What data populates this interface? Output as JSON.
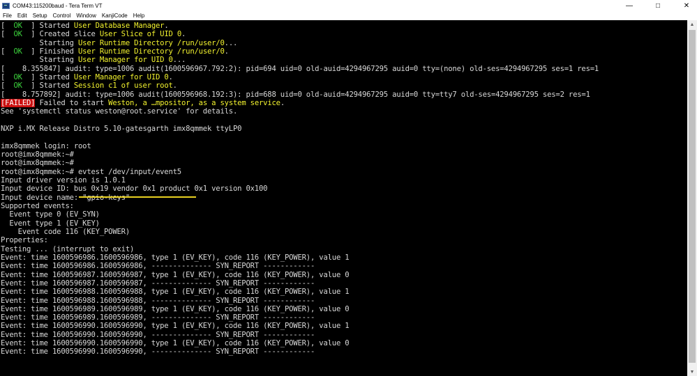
{
  "titlebar": {
    "title": "COM43:115200baud - Tera Term VT",
    "minimize": "—",
    "maximize": "□",
    "close": "✕"
  },
  "menu": [
    "File",
    "Edit",
    "Setup",
    "Control",
    "Window",
    "KanjiCode",
    "Help"
  ],
  "colors": {
    "ok": "#3cd23c",
    "highlight": "#f2f22e",
    "failed_bg": "#cc1010",
    "underline": "#e8d020"
  },
  "terminal": {
    "lines": [
      [
        {
          "t": "[  "
        },
        {
          "t": "OK",
          "c": "ok"
        },
        {
          "t": "  ] Started "
        },
        {
          "t": "User Database Manager",
          "c": "hl"
        },
        {
          "t": "."
        }
      ],
      [
        {
          "t": "[  "
        },
        {
          "t": "OK",
          "c": "ok"
        },
        {
          "t": "  ] Created slice "
        },
        {
          "t": "User Slice of UID 0",
          "c": "hl"
        },
        {
          "t": "."
        }
      ],
      [
        {
          "t": "         Starting "
        },
        {
          "t": "User Runtime Directory /run/user/0",
          "c": "hl"
        },
        {
          "t": "..."
        }
      ],
      [
        {
          "t": "[  "
        },
        {
          "t": "OK",
          "c": "ok"
        },
        {
          "t": "  ] Finished "
        },
        {
          "t": "User Runtime Directory /run/user/0",
          "c": "hl"
        },
        {
          "t": "."
        }
      ],
      [
        {
          "t": "         Starting "
        },
        {
          "t": "User Manager for UID 0",
          "c": "hl"
        },
        {
          "t": "..."
        }
      ],
      [
        {
          "t": "[    8.355847] audit: type=1006 audit(1600596967.792:2): pid=694 uid=0 old-auid=4294967295 auid=0 tty=(none) old-ses=4294967295 ses=1 res=1"
        }
      ],
      [
        {
          "t": "[  "
        },
        {
          "t": "OK",
          "c": "ok"
        },
        {
          "t": "  ] Started "
        },
        {
          "t": "User Manager for UID 0",
          "c": "hl"
        },
        {
          "t": "."
        }
      ],
      [
        {
          "t": "[  "
        },
        {
          "t": "OK",
          "c": "ok"
        },
        {
          "t": "  ] Started "
        },
        {
          "t": "Session c1 of user root",
          "c": "hl"
        },
        {
          "t": "."
        }
      ],
      [
        {
          "t": "[    8.757892] audit: type=1006 audit(1600596968.192:3): pid=688 uid=0 old-auid=4294967295 auid=0 tty=tty7 old-ses=4294967295 ses=2 res=1"
        }
      ],
      [
        {
          "t": "[",
          "c": "fail"
        },
        {
          "t": "FAILED",
          "c": "fail"
        },
        {
          "t": "]",
          "c": "fail"
        },
        {
          "t": " Failed to start "
        },
        {
          "t": "Weston, a …mpositor, as a system service",
          "c": "hl"
        },
        {
          "t": "."
        }
      ],
      [
        {
          "t": "See 'systemctl status weston@root.service' for details."
        }
      ],
      [
        {
          "t": ""
        }
      ],
      [
        {
          "t": "NXP i.MX Release Distro 5.10-gatesgarth imx8qmmek ttyLP0"
        }
      ],
      [
        {
          "t": ""
        }
      ],
      [
        {
          "t": "imx8qmmek login: root"
        }
      ],
      [
        {
          "t": "root@imx8qmmek:~#"
        }
      ],
      [
        {
          "t": "root@imx8qmmek:~#"
        }
      ],
      [
        {
          "t": "root@imx8qmmek:~# evtest /dev/input/event5"
        }
      ],
      [
        {
          "t": "Input driver version is 1.0.1"
        }
      ],
      [
        {
          "t": "Input device ID: bus 0x19 vendor 0x1 product 0x1 version 0x100"
        }
      ],
      [
        {
          "t": "Input device name: \"gpio-keys\""
        }
      ],
      [
        {
          "t": "Supported events:"
        }
      ],
      [
        {
          "t": "  Event type 0 (EV_SYN)"
        }
      ],
      [
        {
          "t": "  Event type 1 (EV_KEY)"
        }
      ],
      [
        {
          "t": "    Event code 116 (KEY_POWER)"
        }
      ],
      [
        {
          "t": "Properties:"
        }
      ],
      [
        {
          "t": "Testing ... (interrupt to exit)"
        }
      ],
      [
        {
          "t": "Event: time 1600596986.1600596986, type 1 (EV_KEY), code 116 (KEY_POWER), value 1"
        }
      ],
      [
        {
          "t": "Event: time 1600596986.1600596986, -------------- SYN_REPORT ------------"
        }
      ],
      [
        {
          "t": "Event: time 1600596987.1600596987, type 1 (EV_KEY), code 116 (KEY_POWER), value 0"
        }
      ],
      [
        {
          "t": "Event: time 1600596987.1600596987, -------------- SYN_REPORT ------------"
        }
      ],
      [
        {
          "t": "Event: time 1600596988.1600596988, type 1 (EV_KEY), code 116 (KEY_POWER), value 1"
        }
      ],
      [
        {
          "t": "Event: time 1600596988.1600596988, -------------- SYN_REPORT ------------"
        }
      ],
      [
        {
          "t": "Event: time 1600596989.1600596989, type 1 (EV_KEY), code 116 (KEY_POWER), value 0"
        }
      ],
      [
        {
          "t": "Event: time 1600596989.1600596989, -------------- SYN_REPORT ------------"
        }
      ],
      [
        {
          "t": "Event: time 1600596990.1600596990, type 1 (EV_KEY), code 116 (KEY_POWER), value 1"
        }
      ],
      [
        {
          "t": "Event: time 1600596990.1600596990, -------------- SYN_REPORT ------------"
        }
      ],
      [
        {
          "t": "Event: time 1600596990.1600596990, type 1 (EV_KEY), code 116 (KEY_POWER), value 0"
        }
      ],
      [
        {
          "t": "Event: time 1600596990.1600596990, -------------- SYN_REPORT ------------"
        }
      ]
    ]
  }
}
